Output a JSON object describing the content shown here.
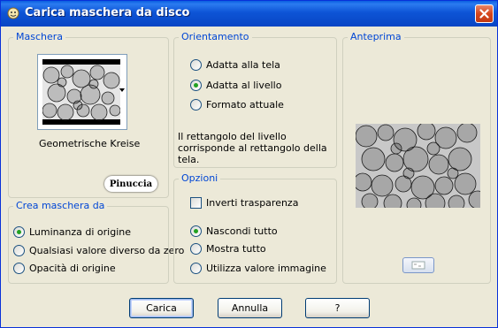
{
  "window": {
    "title": "Carica maschera da disco"
  },
  "mask_group": {
    "legend": "Maschera",
    "selected_name": "Geometrische Kreise",
    "logo_text": "Pinuccia"
  },
  "orientation_group": {
    "legend": "Orientamento",
    "options": [
      {
        "label": "Adatta alla tela",
        "checked": false
      },
      {
        "label": "Adatta al livello",
        "checked": true
      },
      {
        "label": "Formato attuale",
        "checked": false
      }
    ],
    "description": "Il rettangolo del livello corrisponde al rettangolo della tela."
  },
  "preview_group": {
    "legend": "Anteprima"
  },
  "create_group": {
    "legend": "Crea maschera da",
    "options": [
      {
        "label": "Luminanza di origine",
        "checked": true
      },
      {
        "label": "Qualsiasi valore diverso da zero",
        "checked": false
      },
      {
        "label": "Opacità di origine",
        "checked": false
      }
    ]
  },
  "options_group": {
    "legend": "Opzioni",
    "invert_label": "Inverti trasparenza",
    "invert_checked": false,
    "options": [
      {
        "label": "Nascondi tutto",
        "checked": true
      },
      {
        "label": "Mostra tutto",
        "checked": false
      },
      {
        "label": "Utilizza valore immagine",
        "checked": false
      }
    ]
  },
  "buttons": {
    "load": "Carica",
    "cancel": "Annulla",
    "help": "?"
  },
  "colors": {
    "title_bar": "#0A5FE0",
    "dialog_bg": "#ECE9D8",
    "legend_text": "#0046D5",
    "radio_checked": "#21A121"
  }
}
